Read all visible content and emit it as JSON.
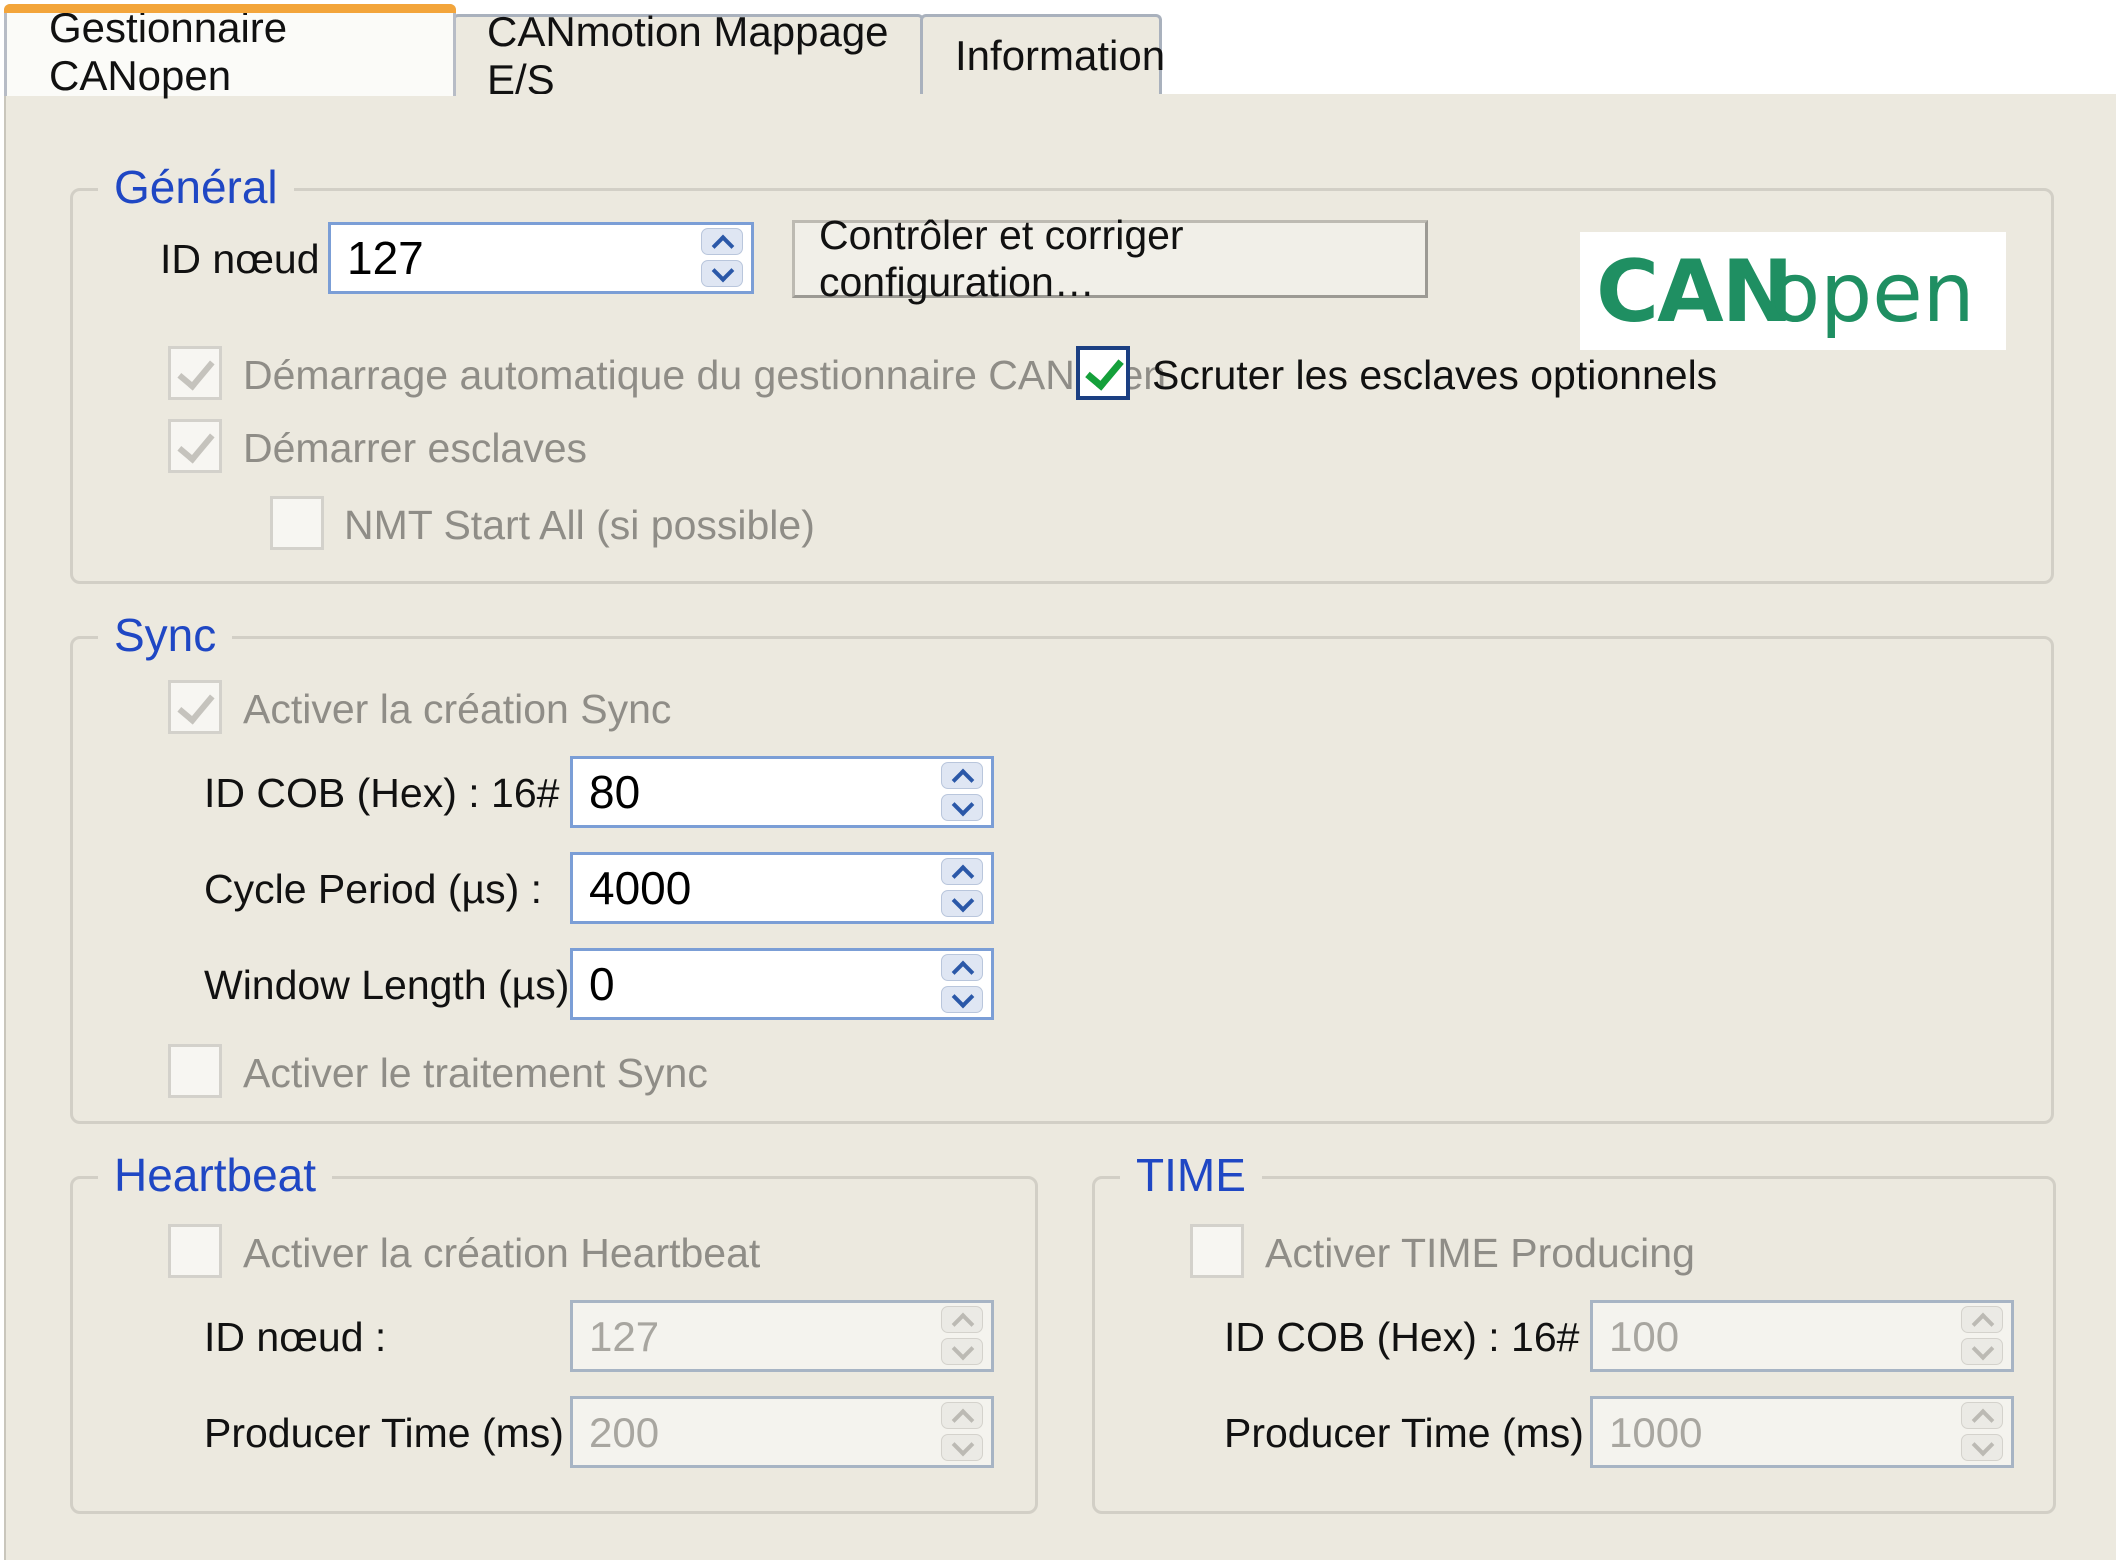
{
  "tabs": [
    {
      "label": "Gestionnaire CANopen",
      "active": true
    },
    {
      "label": "CANmotion Mappage E/S",
      "active": false
    },
    {
      "label": "Information",
      "active": false
    }
  ],
  "general": {
    "title": "Général",
    "node_id_label": "ID nœud :",
    "node_id_value": "127",
    "check_button_label": "Contrôler et corriger configuration…",
    "logo": {
      "part1": "CAN",
      "part2": "open"
    },
    "auto_start_label": "Démarrage automatique du gestionnaire CANopen",
    "auto_start_checked": true,
    "scan_optional_label": "Scruter les esclaves optionnels",
    "scan_optional_checked": true,
    "start_slaves_label": "Démarrer esclaves",
    "start_slaves_checked": true,
    "nmt_start_all_label": "NMT Start All (si possible)",
    "nmt_start_all_checked": false
  },
  "sync": {
    "title": "Sync",
    "enable_label": "Activer la création Sync",
    "enable_checked": true,
    "cob_id_label": "ID COB (Hex) : 16#",
    "cob_id_value": "80",
    "cycle_period_label": "Cycle Period (µs) :",
    "cycle_period_value": "4000",
    "window_length_label": "Window Length (µs) :",
    "window_length_value": "0",
    "process_label": "Activer le traitement Sync",
    "process_checked": false
  },
  "heartbeat": {
    "title": "Heartbeat",
    "enable_label": "Activer la création Heartbeat",
    "enable_checked": false,
    "node_id_label": "ID nœud :",
    "node_id_value": "127",
    "producer_time_label": "Producer Time (ms) :",
    "producer_time_value": "200"
  },
  "time": {
    "title": "TIME",
    "enable_label": "Activer TIME Producing",
    "enable_checked": false,
    "cob_id_label": "ID COB (Hex) : 16#",
    "cob_id_value": "100",
    "producer_time_label": "Producer Time (ms) :",
    "producer_time_value": "1000"
  },
  "colors": {
    "group_title": "#1f47c4",
    "panel_bg": "#ece9df",
    "active_tab_accent": "#f3a53b",
    "check_green": "#14a03a"
  }
}
